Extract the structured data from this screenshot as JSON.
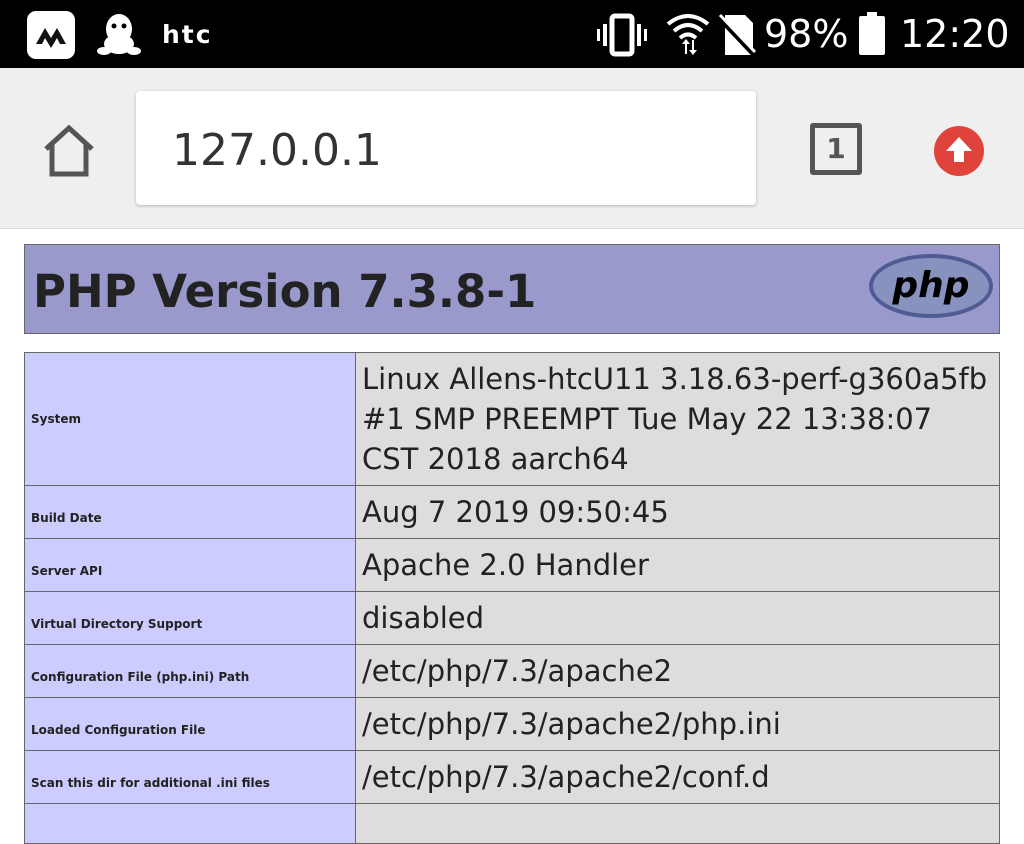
{
  "status_bar": {
    "carrier": "htc",
    "battery_percent": "98%",
    "time": "12:20"
  },
  "browser": {
    "url": "127.0.0.1",
    "tab_count": "1"
  },
  "page": {
    "title": "PHP Version 7.3.8-1",
    "logo_text": "php",
    "rows": [
      {
        "label": "System",
        "value": "Linux Allens-htcU11 3.18.63-perf-g360a5fb #1 SMP PREEMPT Tue May 22 13:38:07 CST 2018 aarch64"
      },
      {
        "label": "Build Date",
        "value": "Aug 7 2019 09:50:45"
      },
      {
        "label": "Server API",
        "value": "Apache 2.0 Handler"
      },
      {
        "label": "Virtual Directory Support",
        "value": "disabled"
      },
      {
        "label": "Configuration File (php.ini) Path",
        "value": "/etc/php/7.3/apache2"
      },
      {
        "label": "Loaded Configuration File",
        "value": "/etc/php/7.3/apache2/php.ini"
      },
      {
        "label": "Scan this dir for additional .ini files",
        "value": "/etc/php/7.3/apache2/conf.d"
      }
    ]
  },
  "colors": {
    "header_bg": "#9999cc",
    "label_cell_bg": "#ccccff",
    "value_cell_bg": "#dddddd",
    "upload_button": "#e0433b"
  }
}
